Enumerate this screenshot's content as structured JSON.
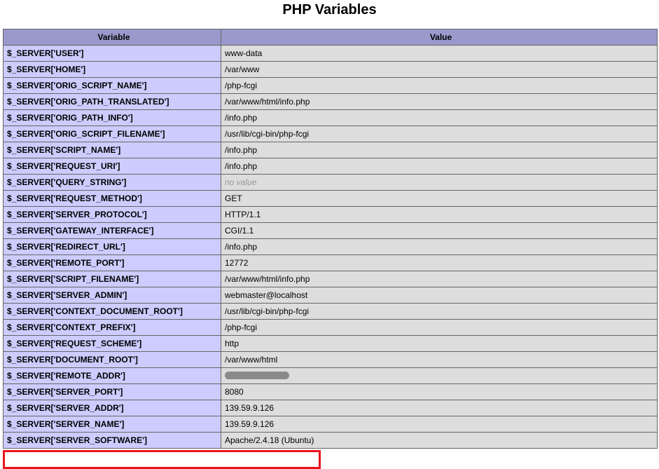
{
  "title": "PHP Variables",
  "table": {
    "headers": [
      "Variable",
      "Value"
    ],
    "rows": [
      {
        "variable": "$_SERVER['USER']",
        "value": "www-data"
      },
      {
        "variable": "$_SERVER['HOME']",
        "value": "/var/www"
      },
      {
        "variable": "$_SERVER['ORIG_SCRIPT_NAME']",
        "value": "/php-fcgi"
      },
      {
        "variable": "$_SERVER['ORIG_PATH_TRANSLATED']",
        "value": "/var/www/html/info.php"
      },
      {
        "variable": "$_SERVER['ORIG_PATH_INFO']",
        "value": "/info.php"
      },
      {
        "variable": "$_SERVER['ORIG_SCRIPT_FILENAME']",
        "value": "/usr/lib/cgi-bin/php-fcgi"
      },
      {
        "variable": "$_SERVER['SCRIPT_NAME']",
        "value": "/info.php"
      },
      {
        "variable": "$_SERVER['REQUEST_URI']",
        "value": "/info.php"
      },
      {
        "variable": "$_SERVER['QUERY_STRING']",
        "value": "no value"
      },
      {
        "variable": "$_SERVER['REQUEST_METHOD']",
        "value": "GET"
      },
      {
        "variable": "$_SERVER['SERVER_PROTOCOL']",
        "value": "HTTP/1.1"
      },
      {
        "variable": "$_SERVER['GATEWAY_INTERFACE']",
        "value": "CGI/1.1"
      },
      {
        "variable": "$_SERVER['REDIRECT_URL']",
        "value": "/info.php"
      },
      {
        "variable": "$_SERVER['REMOTE_PORT']",
        "value": "12772"
      },
      {
        "variable": "$_SERVER['SCRIPT_FILENAME']",
        "value": "/var/www/html/info.php"
      },
      {
        "variable": "$_SERVER['SERVER_ADMIN']",
        "value": "webmaster@localhost"
      },
      {
        "variable": "$_SERVER['CONTEXT_DOCUMENT_ROOT']",
        "value": "/usr/lib/cgi-bin/php-fcgi"
      },
      {
        "variable": "$_SERVER['CONTEXT_PREFIX']",
        "value": "/php-fcgi"
      },
      {
        "variable": "$_SERVER['REQUEST_SCHEME']",
        "value": "http"
      },
      {
        "variable": "$_SERVER['DOCUMENT_ROOT']",
        "value": "/var/www/html"
      },
      {
        "variable": "$_SERVER['REMOTE_ADDR']",
        "value": ""
      },
      {
        "variable": "$_SERVER['SERVER_PORT']",
        "value": "8080"
      },
      {
        "variable": "$_SERVER['SERVER_ADDR']",
        "value": "139.59.9.126"
      },
      {
        "variable": "$_SERVER['SERVER_NAME']",
        "value": "139.59.9.126"
      },
      {
        "variable": "$_SERVER['SERVER_SOFTWARE']",
        "value": "Apache/2.4.18 (Ubuntu)"
      }
    ]
  },
  "colors": {
    "header_bg": "#9999cc",
    "key_cell_bg": "#ccccff",
    "value_cell_bg": "#dddddd",
    "highlight_border": "#e8141c"
  }
}
